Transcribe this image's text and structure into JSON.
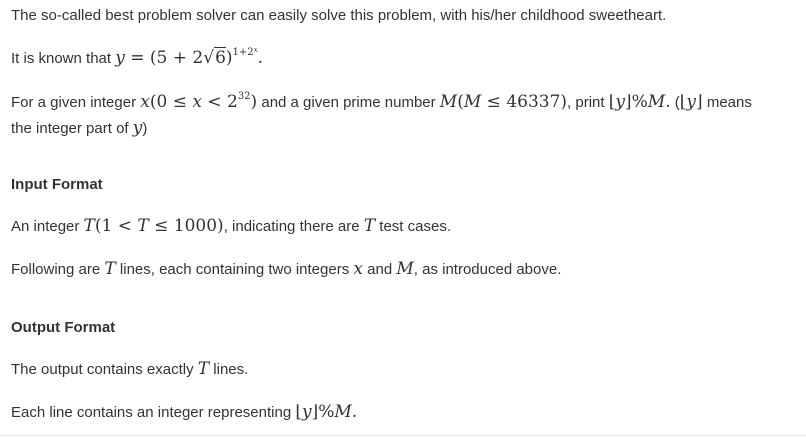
{
  "intro": "The so-called best problem solver can easily solve this problem, with his/her childhood sweetheart.",
  "known_prefix": "It is known that",
  "known_formula": {
    "lhs": "y",
    "eq": " = ",
    "base": "(5 + 2",
    "radicand": "6",
    "close": ")",
    "exponent_base": "1+2",
    "exponent_sup": "x",
    "end": "."
  },
  "given": {
    "t1": "For a given integer ",
    "m1": "x",
    "m2": "(0 ≤ ",
    "m3": "x",
    "m4": " < 2",
    "m4sup": "32",
    "m5": ")",
    "t2": " and a given prime number ",
    "m6": "M",
    "m7": "(",
    "m8": "M",
    "m9": " ≤ 46337)",
    "t3": ", print ",
    "m10": "⌊",
    "m11": "y",
    "m12": "⌋%",
    "m13": "M",
    "m14": ".",
    "t4": " (",
    "m15": "⌊",
    "m16": "y",
    "m17": "⌋",
    "t5": " means",
    "line2_text": "the integer part of ",
    "line2_var": "y",
    "line2_end": ")"
  },
  "input_heading": "Input Format",
  "input_line1": {
    "t1": "An integer ",
    "m1": "T",
    "m2": "(1 < ",
    "m3": "T",
    "m4": " ≤ 1000)",
    "t2": ", indicating there are ",
    "m5": "T",
    "t3": " test cases."
  },
  "input_line2": {
    "t1": "Following are ",
    "m1": "T",
    "t2": " lines, each containing two integers ",
    "m2": "x",
    "t3": " and ",
    "m3": "M",
    "t4": ", as introduced above."
  },
  "output_heading": "Output Format",
  "output_line1": {
    "t1": "The output contains exactly ",
    "m1": "T",
    "t2": " lines."
  },
  "output_line2": {
    "t1": "Each line contains an integer representing ",
    "m1": "⌊",
    "m2": "y",
    "m3": "⌋%",
    "m4": "M",
    "m5": "."
  }
}
